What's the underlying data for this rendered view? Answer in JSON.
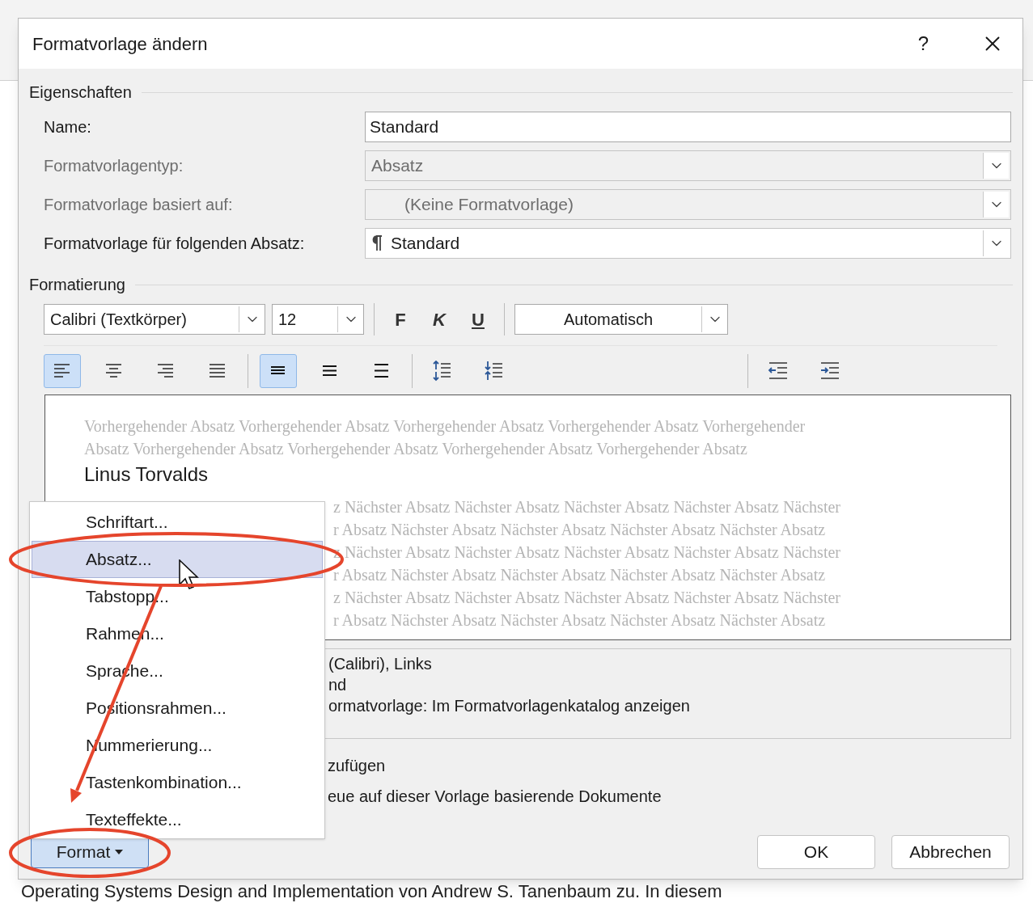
{
  "dialog": {
    "title": "Formatvorlage ändern",
    "help": "?"
  },
  "properties": {
    "heading": "Eigenschaften",
    "fields": [
      {
        "label": "Name:",
        "value": "Standard",
        "kind": "text",
        "disabled": false,
        "style_mark": false
      },
      {
        "label": "Formatvorlagentyp:",
        "value": "Absatz",
        "kind": "dropdown",
        "disabled": true,
        "style_mark": false
      },
      {
        "label": "Formatvorlage basiert auf:",
        "value": "(Keine Formatvorlage)",
        "kind": "dropdown",
        "disabled": true,
        "style_mark": false
      },
      {
        "label": "Formatvorlage für folgenden Absatz:",
        "value": "Standard",
        "kind": "dropdown",
        "disabled": false,
        "style_mark": true
      }
    ]
  },
  "formatting": {
    "heading": "Formatierung",
    "font": "Calibri (Textkörper)",
    "size": "12",
    "styles": [
      {
        "label": "F",
        "kind": "bold"
      },
      {
        "label": "K",
        "kind": "italic"
      },
      {
        "label": "U",
        "kind": "underline"
      }
    ],
    "font_color_setting": "Automatisch",
    "paragraph_groups": [
      [
        {
          "kind": "align-left",
          "selected": true
        },
        {
          "kind": "align-center",
          "selected": false
        },
        {
          "kind": "align-right",
          "selected": false
        },
        {
          "kind": "justify",
          "selected": false
        }
      ],
      [
        {
          "kind": "spacing-single",
          "selected": true
        },
        {
          "kind": "spacing-onehalf",
          "selected": false
        },
        {
          "kind": "spacing-double",
          "selected": false
        }
      ],
      [
        {
          "kind": "space-increase",
          "selected": false
        },
        {
          "kind": "space-decrease",
          "selected": false
        }
      ],
      [
        {
          "kind": "indent-decrease",
          "selected": false
        },
        {
          "kind": "indent-increase",
          "selected": false
        }
      ]
    ]
  },
  "preview": {
    "preceding_lines": [
      "Vorhergehender Absatz Vorhergehender Absatz Vorhergehender Absatz Vorhergehender Absatz Vorhergehender",
      "Absatz Vorhergehender Absatz Vorhergehender Absatz Vorhergehender Absatz Vorhergehender Absatz"
    ],
    "sample": "Linus Torvalds",
    "following_lines": [
      "z Nächster Absatz Nächster Absatz Nächster Absatz Nächster Absatz Nächster",
      "r Absatz Nächster Absatz Nächster Absatz Nächster Absatz Nächster Absatz",
      "z Nächster Absatz Nächster Absatz Nächster Absatz Nächster Absatz Nächster",
      "r Absatz Nächster Absatz Nächster Absatz Nächster Absatz Nächster Absatz",
      "z Nächster Absatz Nächster Absatz Nächster Absatz Nächster Absatz Nächster",
      "r Absatz Nächster Absatz Nächster Absatz Nächster Absatz Nächster Absatz"
    ]
  },
  "description_lines": [
    "(Calibri), Links",
    "nd",
    "ormatvorlage: Im Formatvorlagenkatalog anzeigen"
  ],
  "option_lines": [
    "zufügen",
    "eue auf dieser Vorlage basierende Dokumente"
  ],
  "format_menu": {
    "items": [
      {
        "label": "Schriftart...",
        "selected": false
      },
      {
        "label": "Absatz...",
        "selected": true
      },
      {
        "label": "Tabstopp...",
        "selected": false
      },
      {
        "label": "Rahmen...",
        "selected": false
      },
      {
        "label": "Sprache...",
        "selected": false
      },
      {
        "label": "Positionsrahmen...",
        "selected": false
      },
      {
        "label": "Nummerierung...",
        "selected": false
      },
      {
        "label": "Tastenkombination...",
        "selected": false
      },
      {
        "label": "Texteffekte...",
        "selected": false
      }
    ]
  },
  "buttons": {
    "format": {
      "label": "Format",
      "pressed": true
    },
    "ok": "OK",
    "cancel": "Abbrechen"
  },
  "document_text": "Operating Systems Design and Implementation von Andrew S. Tanenbaum zu. In diesem"
}
